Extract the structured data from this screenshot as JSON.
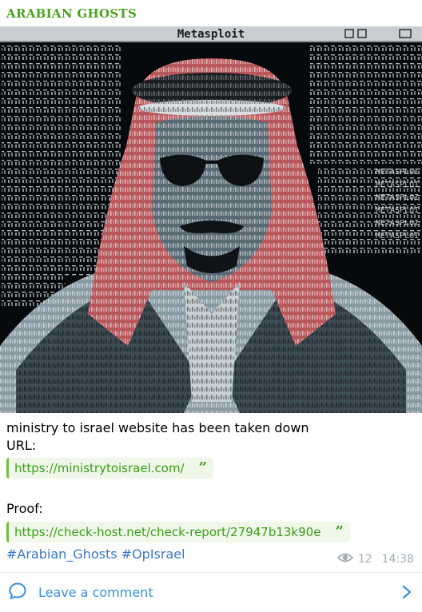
{
  "colors": {
    "channel": "#4aa31e",
    "link": "#3f9c1c",
    "quote_bg": "#eef7e8",
    "quote_bar": "#6fbf3d",
    "hashtag": "#3a76c5",
    "comment_accent": "#3a8fd9",
    "meta": "#a3acb4"
  },
  "post": {
    "channel_name": "ARABIAN GHOSTS",
    "image": {
      "window_title": "Metasploit",
      "alt": "ASCII-art portrait in a Metasploit terminal window"
    },
    "line1": "ministry to israel website has been taken down",
    "url_label": "URL:",
    "url_link": "https://ministrytoisrael.com/",
    "proof_label": "Proof:",
    "proof_link": "https://check-host.net/check-report/27947b13k90e",
    "quote_mark": "”",
    "hashtags": [
      "#Arabian_Ghosts",
      "#OpIsrael"
    ],
    "views": "12",
    "time": "14:38"
  },
  "comments": {
    "label": "Leave a comment"
  }
}
